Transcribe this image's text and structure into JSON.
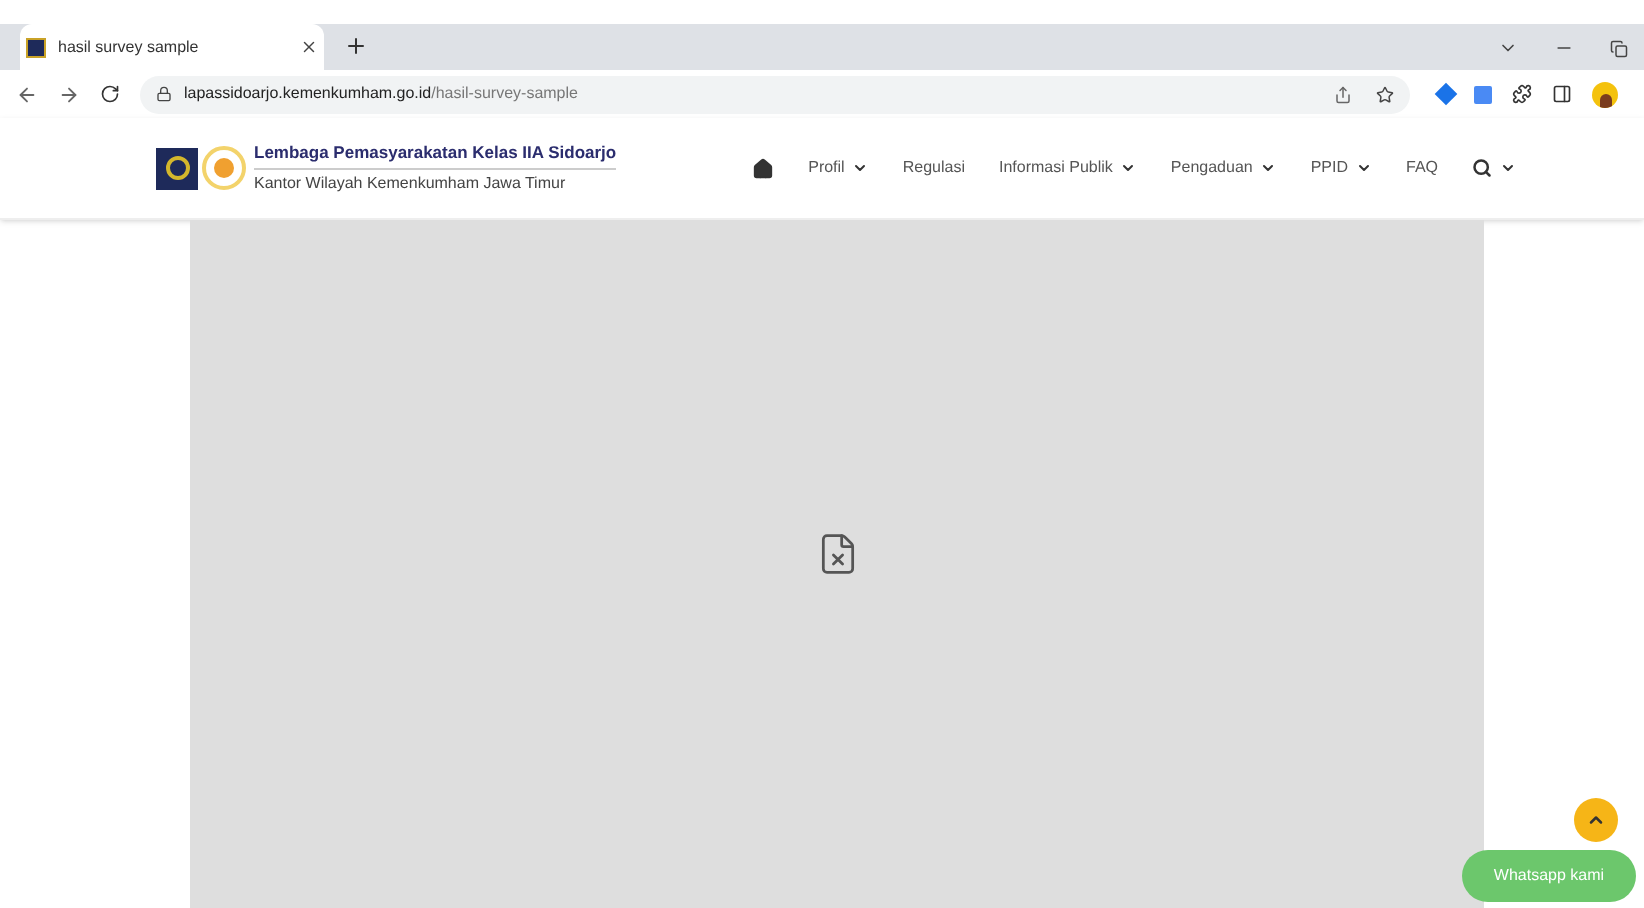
{
  "browser": {
    "tab": {
      "title": "hasil survey sample",
      "selected": true
    },
    "url": {
      "host": "lapassidoarjo.kemenkumham.go.id",
      "path": "/hasil-survey-sample"
    }
  },
  "site": {
    "title": "Lembaga Pemasyarakatan Kelas IIA Sidoarjo",
    "subtitle": "Kantor Wilayah Kemenkumham Jawa Timur",
    "nav": [
      {
        "kind": "home"
      },
      {
        "kind": "link",
        "label": "Profil",
        "has_menu": true
      },
      {
        "kind": "link",
        "label": "Regulasi",
        "has_menu": false
      },
      {
        "kind": "link",
        "label": "Informasi Publik",
        "has_menu": true
      },
      {
        "kind": "link",
        "label": "Pengaduan",
        "has_menu": true
      },
      {
        "kind": "link",
        "label": "PPID",
        "has_menu": true
      },
      {
        "kind": "link",
        "label": "FAQ",
        "has_menu": false
      },
      {
        "kind": "search",
        "has_menu": true
      }
    ]
  },
  "whatsapp_button": "Whatsapp kami"
}
